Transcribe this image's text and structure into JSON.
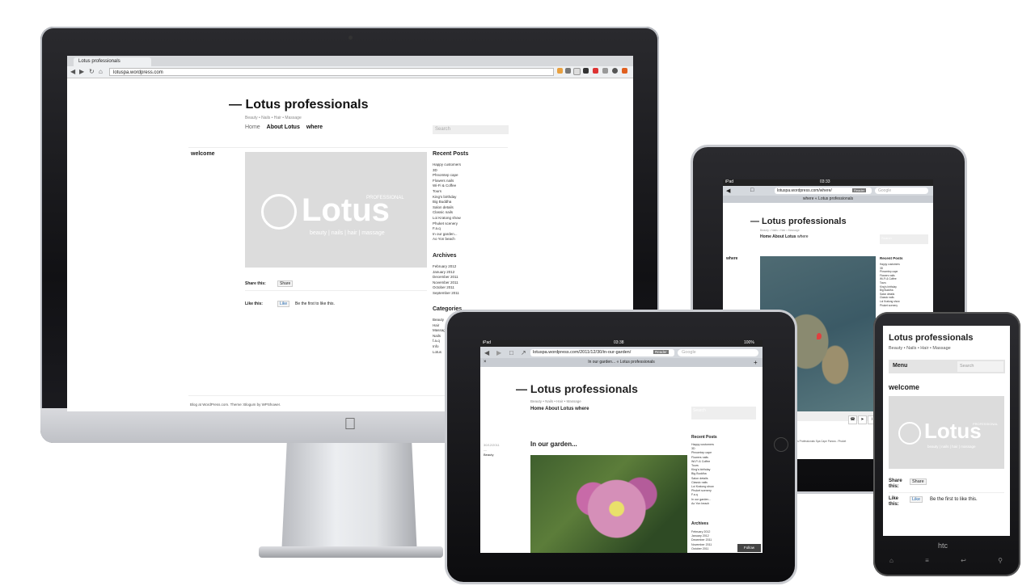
{
  "imac": {
    "browser": {
      "tab_title": "Lotus professionals",
      "url": "lotuspa.wordpress.com"
    },
    "site": {
      "title": "— Lotus professionals",
      "tagline": "Beauty • Nails • Hair • Massage",
      "nav": [
        "Home",
        "About Lotus",
        "where"
      ],
      "search_placeholder": "Search",
      "section_title": "welcome",
      "logo": {
        "word": "Lotus",
        "small": "PROFESSIONAL",
        "sub": "beauty | nails | hair | massage"
      },
      "share_label": "Share this:",
      "share_button": "Share",
      "like_label": "Like this:",
      "like_button": "Like",
      "like_text": "Be the first to like this.",
      "recent_posts_heading": "Recent Posts",
      "recent_posts": [
        "Happy customers",
        "3D",
        "Phnomtep cape",
        "Flowers nails",
        "Wi-Fi & Coffee",
        "Tours",
        "King's birthday",
        "Big Buddha",
        "Salon details",
        "Classic nails",
        "Loi Kratong show",
        "Phuket scenery",
        "F.a.q",
        "In our garden...",
        "Ao Yon beach"
      ],
      "archives_heading": "Archives",
      "archives": [
        "February 2012",
        "January 2012",
        "December 2011",
        "November 2011",
        "October 2011",
        "September 2011"
      ],
      "categories_heading": "Categories",
      "categories": [
        "Beauty",
        "Hair",
        "Massage",
        "Nails",
        "f.a.q",
        "Info",
        "Lotus"
      ],
      "footer": "Blog at WordPress.com. Theme: Blogum by WPShower."
    }
  },
  "ipad_back": {
    "status_left": "iPad",
    "time": "03:33",
    "url": "lotuspa.wordpress.com/where/",
    "reader_button": "Reader",
    "search_placeholder": "Google",
    "page_tab": "where « Lotus professionals",
    "site_title": "— Lotus professionals",
    "tagline": "Beauty • Nails • Hair • Massage",
    "nav": [
      "Home",
      "About Lotus",
      "where"
    ],
    "search_box": "Search",
    "section_title": "where",
    "recent_posts_heading": "Recent Posts",
    "recent_posts": [
      "Happy customers",
      "3D",
      "Phnomtep cape",
      "Flowers nails",
      "Wi-Fi & Coffee",
      "Tours",
      "King's birthday",
      "Big Buddha",
      "Salon details",
      "Classic nails",
      "Loi Kratong show",
      "Phuket scenery"
    ],
    "map_caption": "Lotus Professionals Spa Cape Panwa - Phuket",
    "map_location": "buket, Thailand"
  },
  "ipad_front": {
    "status_left": "iPad",
    "time": "03:38",
    "battery": "100%",
    "url": "lotuspa.wordpress.com/2011/12/30/in-our-garden/",
    "reader_button": "Reader",
    "search_placeholder": "Google",
    "page_tab": "In our garden... « Lotus professionals",
    "site_title": "— Lotus professionals",
    "tagline": "Beauty • Nails • Hair • Massage",
    "nav": [
      "Home",
      "About Lotus",
      "where"
    ],
    "search_box": "Search",
    "post_date": "30/12/2011",
    "post_sep": "—",
    "post_category": "Beauty",
    "post_title": "In our garden...",
    "recent_posts_heading": "Recent Posts",
    "recent_posts": [
      "Happy customers",
      "3D",
      "Phnomtep cape",
      "Flowers nails",
      "Wi-Fi & Coffee",
      "Tours",
      "King's birthday",
      "Big Buddha",
      "Salon details",
      "Classic nails",
      "Loi Kratong show",
      "Phuket scenery",
      "F.a.q",
      "In our garden...",
      "Ao Yon beach"
    ],
    "archives_heading": "Archives",
    "archives": [
      "February 2012",
      "January 2012",
      "December 2011",
      "November 2011",
      "October 2011"
    ],
    "follow_button": "Follow"
  },
  "phone": {
    "site_title": "Lotus professionals",
    "tagline": "Beauty • Nails • Hair • Massage",
    "menu_label": "Menu",
    "search_placeholder": "Search",
    "section_title": "welcome",
    "share_label": "Share this:",
    "share_button": "Share",
    "like_label": "Like this:",
    "like_button": "Like",
    "like_text": "Be the first to like this.",
    "brand": "htc"
  }
}
